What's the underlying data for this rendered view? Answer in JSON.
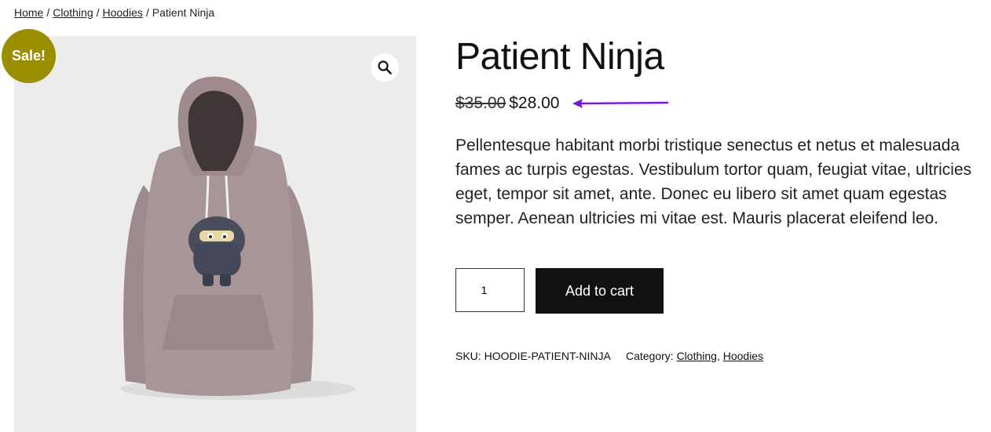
{
  "breadcrumb": {
    "home": "Home",
    "clothing": "Clothing",
    "hoodies": "Hoodies",
    "current": "Patient Ninja",
    "separator": "/"
  },
  "gallery": {
    "sale_label": "Sale!",
    "zoom_icon": "magnifier-icon",
    "image_alt": "Patient Ninja hoodie"
  },
  "product": {
    "title": "Patient Ninja",
    "price_old": "$35.00",
    "price_new": "$28.00",
    "description": "Pellentesque habitant morbi tristique senectus et netus et malesuada fames ac turpis egestas. Vestibulum tortor quam, feugiat vitae, ultricies eget, tempor sit amet, ante. Donec eu libero sit amet quam egestas semper. Aenean ultricies mi vitae est. Mauris placerat eleifend leo.",
    "quantity": "1",
    "add_to_cart": "Add to cart",
    "sku_label": "SKU:",
    "sku": "HOODIE-PATIENT-NINJA",
    "category_label": "Category:",
    "category_1": "Clothing",
    "category_sep": ",",
    "category_2": "Hoodies"
  },
  "colors": {
    "sale_badge": "#9a8f00",
    "button": "#111111",
    "annotation_arrow": "#7b16d9",
    "gallery_bg": "#ececec",
    "hoodie": "#a89597"
  }
}
